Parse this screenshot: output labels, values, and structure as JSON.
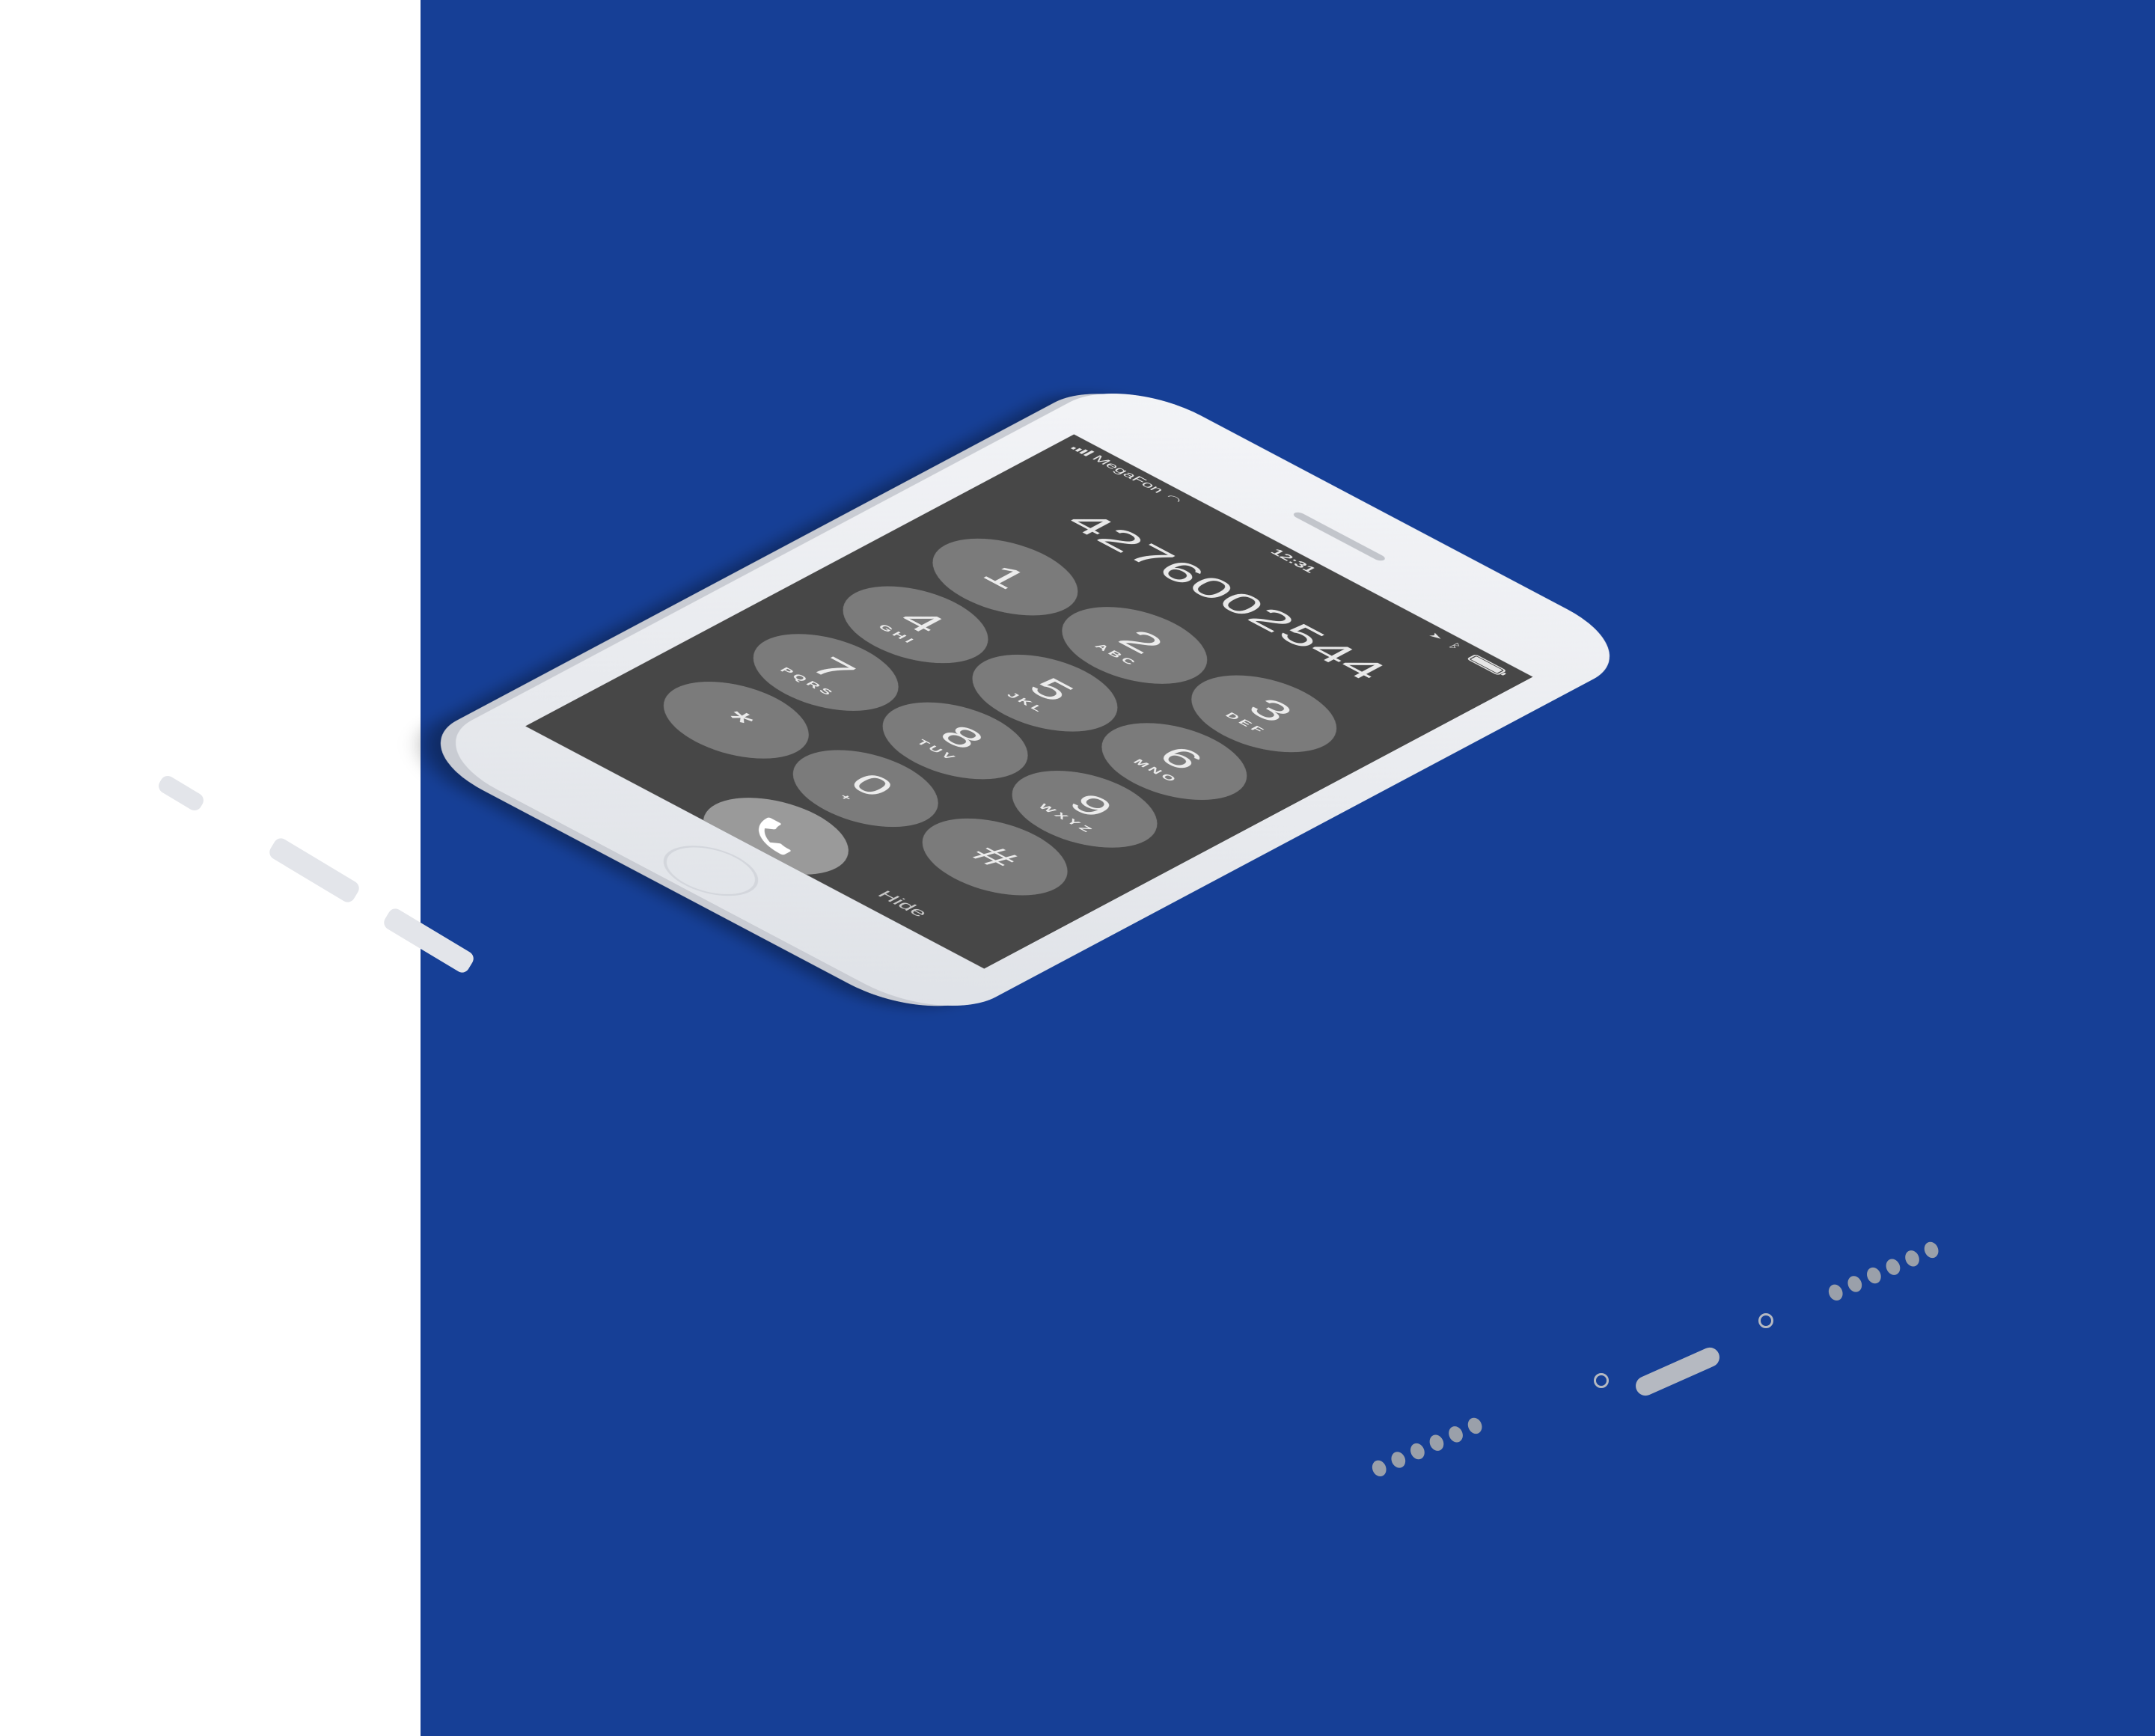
{
  "status_bar": {
    "carrier": "MegaFon",
    "time": "12:31",
    "icons": [
      "signal-icon",
      "wifi-icon",
      "location-icon",
      "bluetooth-icon",
      "battery-icon"
    ]
  },
  "dialed_number": "4276002544",
  "keypad": [
    {
      "digit": "1",
      "letters": ""
    },
    {
      "digit": "2",
      "letters": "ABC"
    },
    {
      "digit": "3",
      "letters": "DEF"
    },
    {
      "digit": "4",
      "letters": "GHI"
    },
    {
      "digit": "5",
      "letters": "JKL"
    },
    {
      "digit": "6",
      "letters": "MNO"
    },
    {
      "digit": "7",
      "letters": "PQRS"
    },
    {
      "digit": "8",
      "letters": "TUV"
    },
    {
      "digit": "9",
      "letters": "WXYZ"
    },
    {
      "digit": "*",
      "letters": ""
    },
    {
      "digit": "0",
      "letters": "+"
    },
    {
      "digit": "#",
      "letters": ""
    }
  ],
  "call_button": {
    "icon": "phone-icon"
  },
  "hide_label": "Hide",
  "colors": {
    "background_left": "#ffffff",
    "background_right": "#163f96",
    "phone_body": "#eceef2",
    "screen": "#474747",
    "key": "#7b7b7b",
    "call_button": "#9a9a9a"
  }
}
